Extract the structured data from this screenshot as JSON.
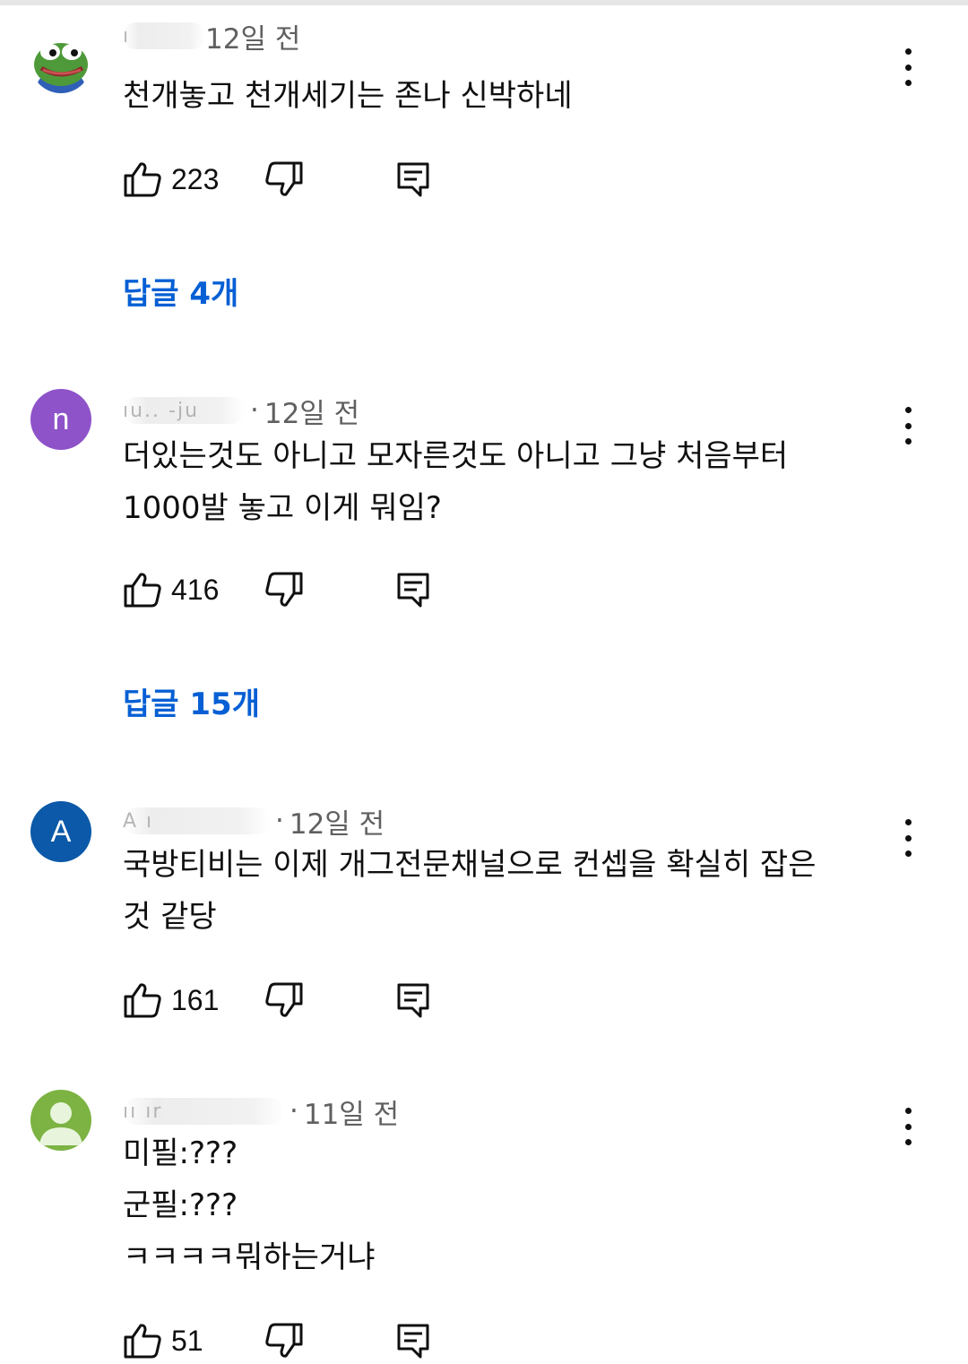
{
  "comments": [
    {
      "author_handle": "",
      "avatar_type": "frog-image",
      "time": "12일 전",
      "text_lines": [
        "천개놓고 천개세기는 존나 신박하네"
      ],
      "likes": "223",
      "replies_label": "답글 4개"
    },
    {
      "author_handle": "",
      "avatar_letter": "n",
      "avatar_color": "#8e52c9",
      "time": "12일 전",
      "text_lines": [
        "더있는것도 아니고 모자른것도 아니고 그냥 처음부터",
        "1000발 놓고 이게 뭐임?"
      ],
      "likes": "416",
      "replies_label": "답글 15개"
    },
    {
      "author_handle": "",
      "avatar_letter": "A",
      "avatar_color": "#0b59a8",
      "time": "12일 전",
      "text_lines": [
        "국방티비는 이제 개그전문채널으로 컨셉을 확실히 잡은",
        "것 같당"
      ],
      "likes": "161"
    },
    {
      "author_handle": "",
      "avatar_type": "default-person",
      "avatar_color": "#7cb342",
      "time": "11일 전",
      "text_lines": [
        "미필:???",
        "군필:???",
        "ㅋㅋㅋㅋ뭐하는거냐"
      ],
      "likes": "51"
    }
  ],
  "icons": {
    "like": "thumb-up-icon",
    "dislike": "thumb-down-icon",
    "reply": "reply-icon",
    "menu": "more-vert-icon"
  },
  "colors": {
    "link_blue": "#065fd4",
    "meta_gray": "#606060"
  }
}
